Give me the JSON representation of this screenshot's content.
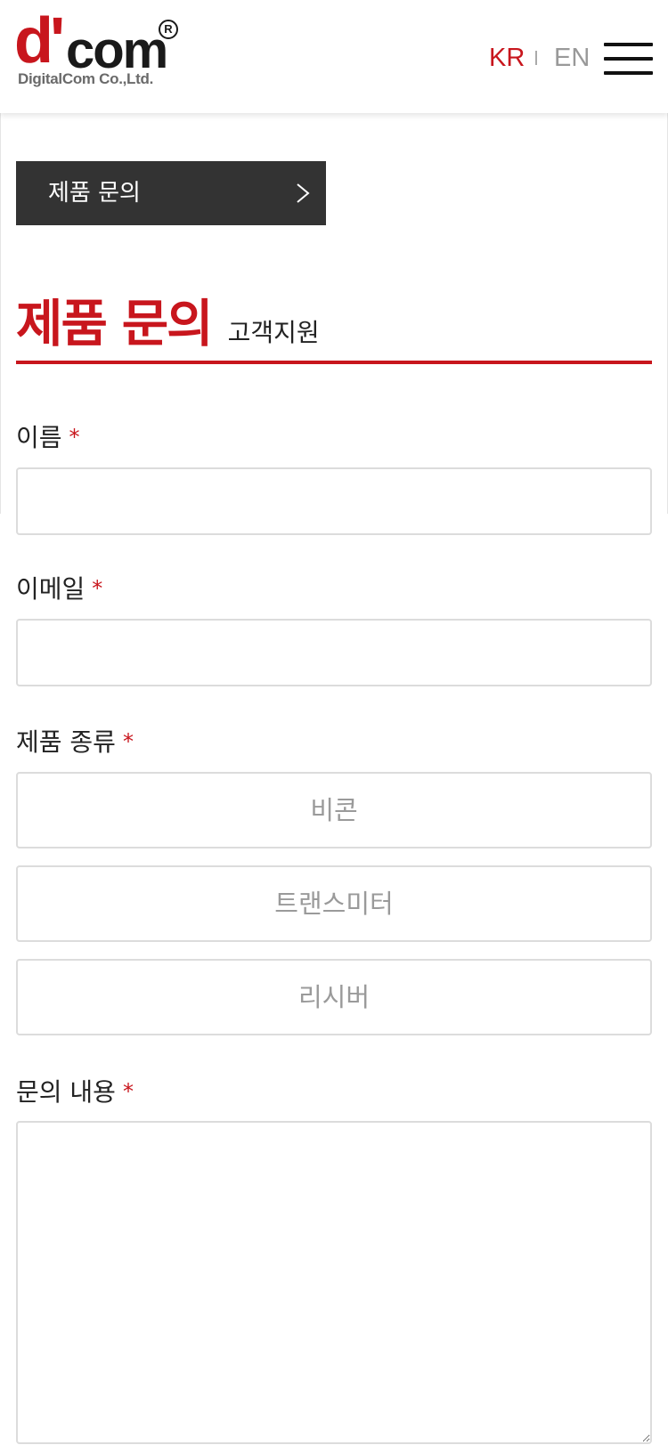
{
  "header": {
    "logo": {
      "mark_d": "d'",
      "mark_com": "com",
      "registered": "R",
      "company": "DigitalCom Co.,Ltd."
    },
    "lang_kr": "KR",
    "lang_en": "EN",
    "menu_icon": "hamburger-menu-icon"
  },
  "breadcrumb": {
    "label": "제품 문의",
    "icon": "chevron-right-icon"
  },
  "page": {
    "title": "제품 문의",
    "subtitle": "고객지원"
  },
  "form": {
    "required_mark": "*",
    "name_label": "이름",
    "name_value": "",
    "email_label": "이메일",
    "email_value": "",
    "product_label": "제품 종류",
    "product_options": [
      "비콘",
      "트랜스미터",
      "리시버"
    ],
    "message_label": "문의 내용",
    "message_value": ""
  },
  "colors": {
    "accent": "#c8161d",
    "crumb_bg": "#333333",
    "border": "#dcdcdc",
    "muted": "#9a9a9a"
  }
}
